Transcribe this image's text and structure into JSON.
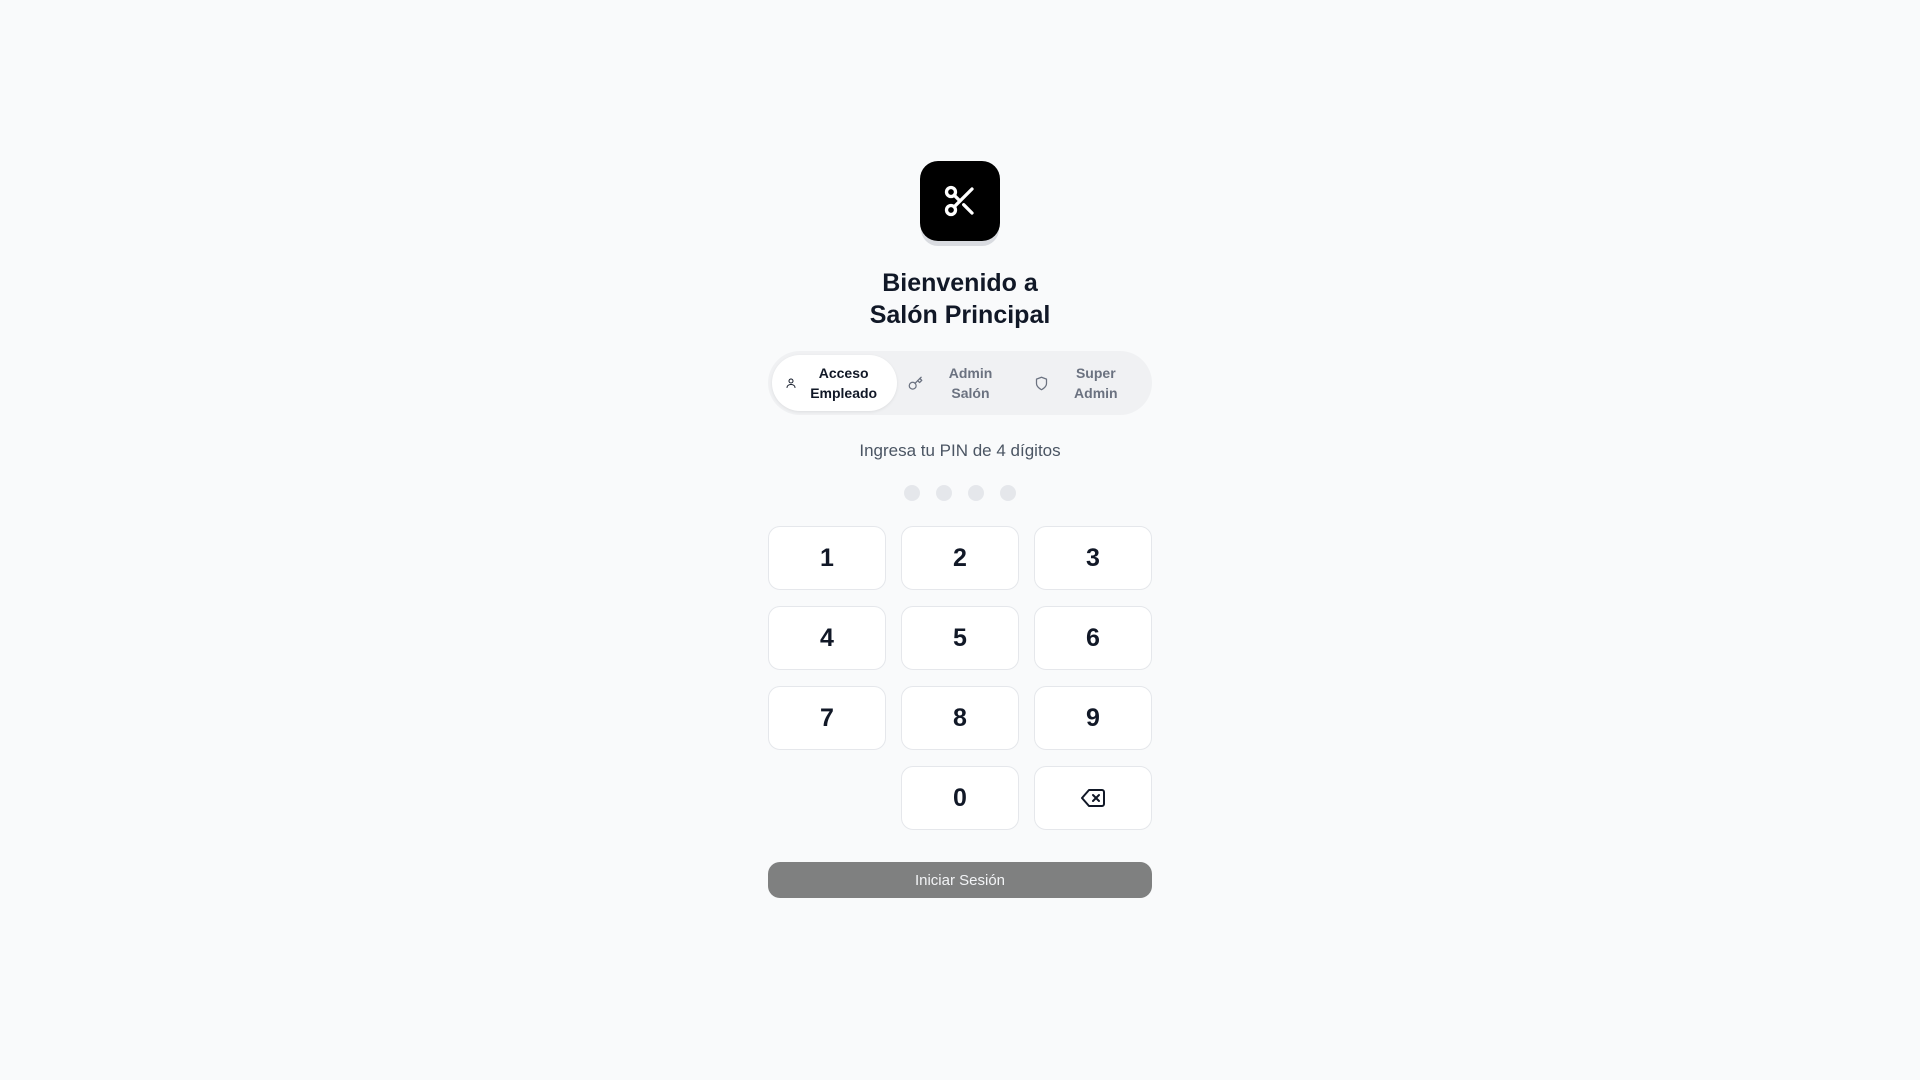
{
  "header": {
    "logo_icon": "scissors-icon",
    "title_line1": "Bienvenido a",
    "title_line2": "Salón Principal"
  },
  "tabs": [
    {
      "label": "Acceso\nEmpleado",
      "icon": "user-icon",
      "active": true
    },
    {
      "label": "Admin\nSalón",
      "icon": "key-icon",
      "active": false
    },
    {
      "label": "Super\nAdmin",
      "icon": "shield-icon",
      "active": false
    }
  ],
  "pin": {
    "prompt": "Ingresa tu PIN de 4 dígitos",
    "length": 4,
    "entered": 0
  },
  "keypad": {
    "keys": [
      "1",
      "2",
      "3",
      "4",
      "5",
      "6",
      "7",
      "8",
      "9",
      "",
      "0",
      "backspace"
    ],
    "backspace_icon": "backspace-icon"
  },
  "submit": {
    "label": "Iniciar Sesión"
  },
  "colors": {
    "background": "#f9fafb",
    "logo_bg": "#000000",
    "submit_bg": "#7f8080",
    "dot_empty": "#e5e7eb"
  }
}
